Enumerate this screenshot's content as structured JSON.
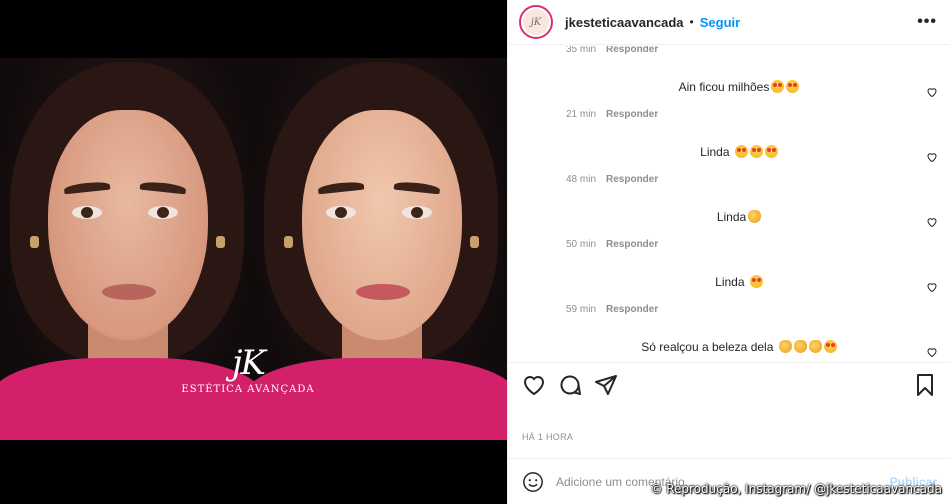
{
  "post": {
    "logo_text": "jK",
    "logo_subtitle": "ESTÉTICA AVANÇADA"
  },
  "header": {
    "avatar_text": "jK",
    "username": "jkesteticaavancada",
    "separator": "•",
    "follow_label": "Seguir",
    "more_label": "•••"
  },
  "comments": [
    {
      "meta_time": "35 min",
      "reply": "Responder",
      "partial": true
    },
    {
      "text": "Ain ficou milhões",
      "emojis": [
        "heart-eyes",
        "heart-eyes"
      ],
      "meta_time": "21 min",
      "reply": "Responder"
    },
    {
      "text": "Linda ",
      "emojis": [
        "heart-eyes",
        "heart-eyes",
        "heart-eyes"
      ],
      "meta_time": "48 min",
      "reply": "Responder"
    },
    {
      "text": "Linda",
      "emojis": [
        "clap"
      ],
      "meta_time": "50 min",
      "reply": "Responder"
    },
    {
      "text": "Linda ",
      "emojis": [
        "heart-eyes"
      ],
      "meta_time": "59 min",
      "reply": "Responder"
    },
    {
      "text": "Só realçou a beleza dela ",
      "emojis": [
        "clap",
        "clap",
        "clap",
        "heart-eyes"
      ]
    }
  ],
  "actions": {
    "icons": [
      "heart-icon",
      "comment-icon",
      "share-icon",
      "bookmark-icon"
    ]
  },
  "time_ago": "HÁ 1 HORA",
  "add_comment": {
    "placeholder": "Adicione um comentário...",
    "publish_label": "Publicar"
  },
  "credit": "© Reprodução, Instagram/ @jkesteticaavancada",
  "colors": {
    "accent": "#0095f6",
    "shirt": "#d3206a",
    "text": "#262626",
    "muted": "#8e8e8e"
  }
}
